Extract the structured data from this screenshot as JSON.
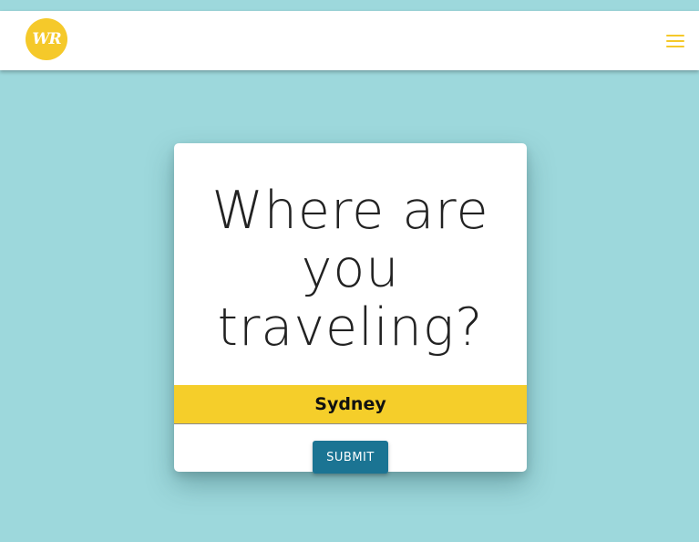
{
  "header": {
    "logo_text": "WR",
    "logo_color": "#f5c92a",
    "menu_icon": "hamburger-menu-icon"
  },
  "card": {
    "heading": "Where are you traveling?",
    "destination_value": "Sydney",
    "submit_label": "SUBMIT"
  },
  "colors": {
    "background": "#9dd8dc",
    "accent_yellow": "#f5ce2a",
    "button_blue": "#1b7493"
  }
}
